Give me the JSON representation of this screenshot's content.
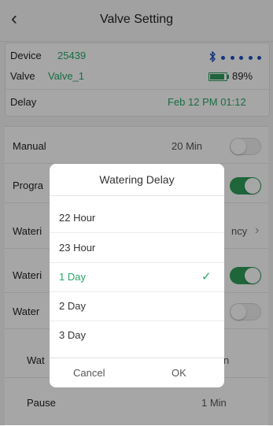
{
  "header": {
    "back_icon": "chevron-left-icon",
    "title": "Valve Setting"
  },
  "device": {
    "device_label": "Device",
    "device_value": "25439",
    "valve_label": "Valve",
    "valve_value": "Valve_1",
    "battery": "89%",
    "battery_level": 0.89,
    "delay_label": "Delay",
    "delay_value": "Feb 12 PM 01:12"
  },
  "settings": {
    "manual_label": "Manual",
    "manual_value": "20 Min",
    "program_label": "Progra",
    "watering_label": "Wateri",
    "watering_value": "ncy",
    "watering2_label": "Wateri",
    "water_label": "Water",
    "wat_label": "Wat",
    "wat_value": "n",
    "pause_label": "Pause",
    "pause_value": "1 Min"
  },
  "dialog": {
    "title": "Watering Delay",
    "options": [
      "22 Hour",
      "23 Hour",
      "1 Day",
      "2 Day",
      "3 Day"
    ],
    "selected": "1 Day",
    "cancel": "Cancel",
    "ok": "OK"
  },
  "colors": {
    "accent": "#27a866",
    "toggle_on": "#2e9d5a",
    "bluetooth": "#1f4fbf"
  }
}
